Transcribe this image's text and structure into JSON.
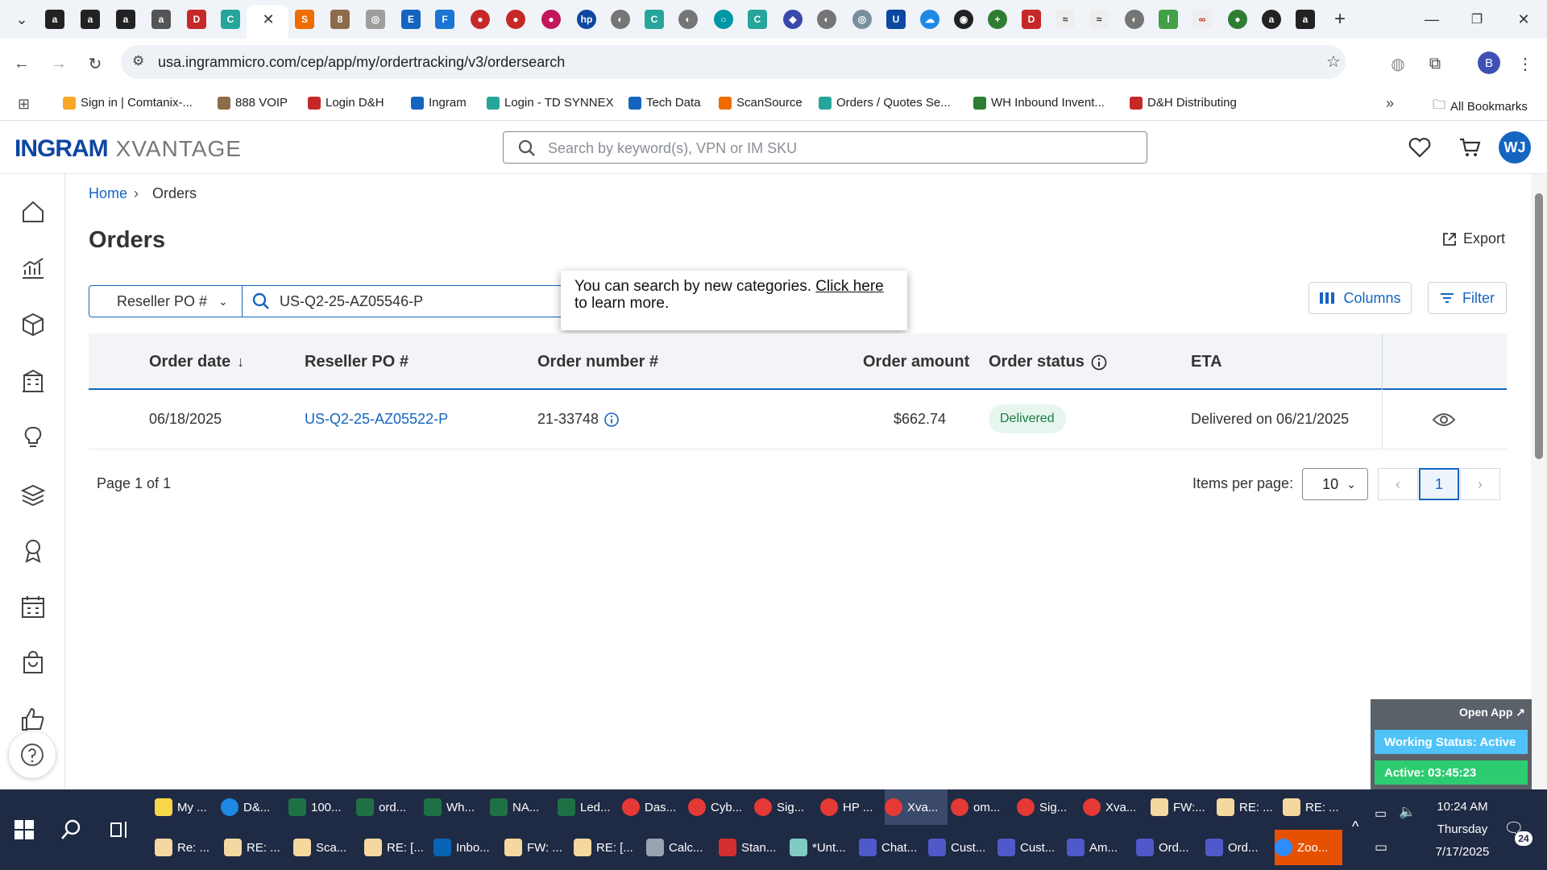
{
  "browser": {
    "url": "usa.ingrammicro.com/cep/app/my/ordertracking/v3/ordersearch",
    "bookmarks": [
      {
        "label": "Sign in | Comtanix-..."
      },
      {
        "label": "888 VOIP"
      },
      {
        "label": "Login D&H"
      },
      {
        "label": "Ingram"
      },
      {
        "label": "Login - TD SYNNEX"
      },
      {
        "label": "Tech Data"
      },
      {
        "label": "ScanSource"
      },
      {
        "label": "Orders / Quotes Se..."
      },
      {
        "label": "WH Inbound Invent..."
      },
      {
        "label": "D&H Distributing"
      }
    ],
    "all_bookmarks": "All Bookmarks",
    "profile_initial": "B"
  },
  "app": {
    "logo_main": "INGRAM",
    "logo_sub": "XVANTAGE",
    "search_placeholder": "Search by keyword(s), VPN or IM SKU",
    "avatar_initials": "WJ"
  },
  "breadcrumb": {
    "home": "Home",
    "current": "Orders"
  },
  "page": {
    "title": "Orders",
    "export_label": "Export",
    "columns_label": "Columns",
    "filter_label": "Filter"
  },
  "search_bar": {
    "category": "Reseller PO #",
    "value": "US-Q2-25-AZ05546-P"
  },
  "tooltip": {
    "text": "You can search by new categories.",
    "link": "Click here",
    "suffix": "to learn more."
  },
  "table": {
    "headers": [
      "Order date",
      "Reseller PO #",
      "Order number #",
      "Order amount",
      "Order status",
      "ETA"
    ],
    "rows": [
      {
        "order_date": "06/18/2025",
        "reseller_po": "US-Q2-25-AZ05522-P",
        "order_number": "21-33748",
        "order_amount": "$662.74",
        "order_status": "Delivered",
        "eta": "Delivered on 06/21/2025"
      }
    ]
  },
  "pagination": {
    "page_text": "Page 1 of 1",
    "items_per_page_label": "Items per page:",
    "items_per_page": "10",
    "current_page": "1"
  },
  "widget": {
    "open_app": "Open App ↗",
    "working_status": "Working Status: Active",
    "active_timer": "Active: 03:45:23"
  },
  "taskbar": {
    "row1": [
      "My ...",
      "D&...",
      "100...",
      "ord...",
      "Wh...",
      "NA...",
      "Led...",
      "Das...",
      "Cyb...",
      "Sig...",
      "HP ...",
      "Xva...",
      "om...",
      "Sig...",
      "Xva...",
      "FW:...",
      "RE: ...",
      "RE: ..."
    ],
    "row2": [
      "Re: ...",
      "RE: ...",
      "Sca...",
      "RE: [...",
      "Inbo...",
      "FW: ...",
      "RE: [...",
      "Calc...",
      "Stan...",
      "*Unt...",
      "Chat...",
      "Cust...",
      "Cust...",
      "Am...",
      "Ord...",
      "Ord...",
      "Zoo..."
    ],
    "time": "10:24 AM",
    "day": "Thursday",
    "date": "7/17/2025",
    "notification_count": "24"
  },
  "colors": {
    "brand_blue": "#1565c0",
    "delivered_bg": "#e6f6ee",
    "delivered_text": "#1b7a43",
    "taskbar": "#1f2a44"
  }
}
